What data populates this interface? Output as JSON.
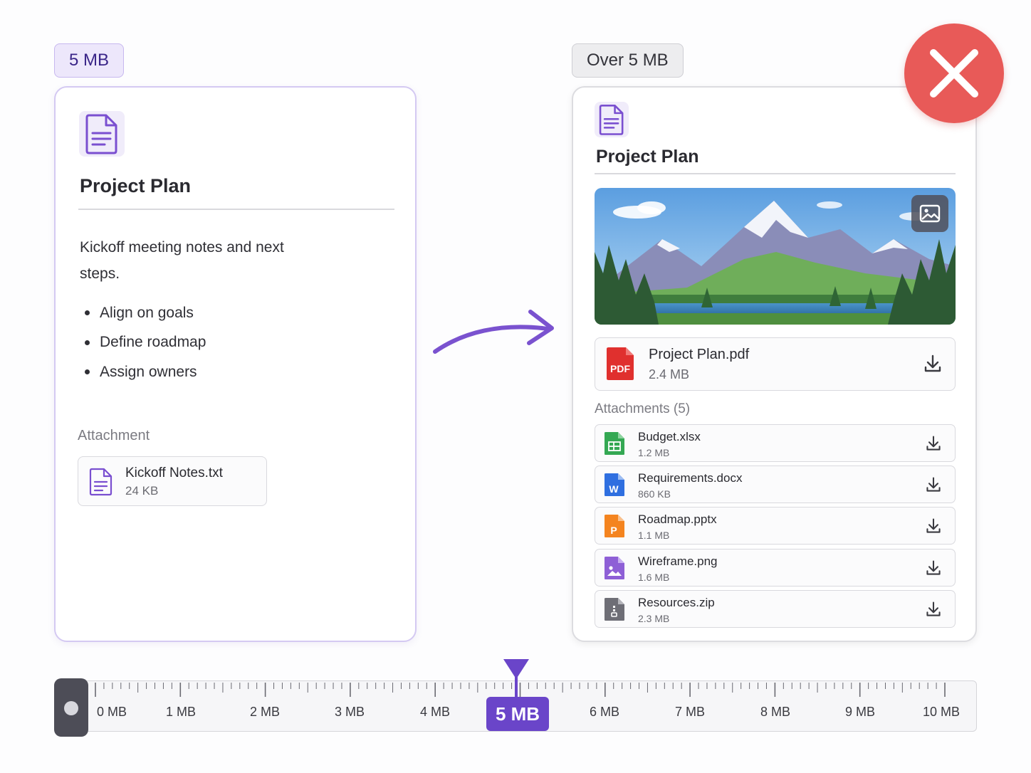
{
  "left_panel": {
    "size_label": "5 MB",
    "title": "Project Plan",
    "description": "Kickoff meeting notes and next steps.",
    "bullets": [
      "Align on goals",
      "Define roadmap",
      "Assign owners"
    ],
    "attachment_label": "Attachment",
    "attachment": {
      "name": "Kickoff Notes.txt",
      "size": "24 KB"
    }
  },
  "right_panel": {
    "size_label": "Over 5 MB",
    "title": "Project Plan",
    "pdf": {
      "name": "Project Plan.pdf",
      "size": "2.4 MB",
      "badge": "PDF"
    },
    "attachments_label": "Attachments (5)",
    "attachments": [
      {
        "name": "Budget.xlsx",
        "size": "1.2 MB",
        "icon": "spreadsheet-icon",
        "color": "#34a853"
      },
      {
        "name": "Requirements.docx",
        "size": "860 KB",
        "icon": "word-doc-icon",
        "color": "#2f6fe0",
        "letter": "W"
      },
      {
        "name": "Roadmap.pptx",
        "size": "1.1 MB",
        "icon": "slides-icon",
        "color": "#f4841f",
        "letter": "P"
      },
      {
        "name": "Wireframe.png",
        "size": "1.6 MB",
        "icon": "image-file-icon",
        "color": "#8e5fd6"
      },
      {
        "name": "Resources.zip",
        "size": "2.3 MB",
        "icon": "zip-file-icon",
        "color": "#6e6e76"
      }
    ]
  },
  "ruler": {
    "labels": [
      "0 MB",
      "1 MB",
      "2 MB",
      "3 MB",
      "4 MB",
      "6 MB",
      "7 MB",
      "8 MB",
      "9 MB",
      "10 MB"
    ],
    "marker_label": "5 MB",
    "marker_value_mb": 5
  },
  "colors": {
    "accent": "#6a45c9",
    "reject": "#e85a58"
  }
}
